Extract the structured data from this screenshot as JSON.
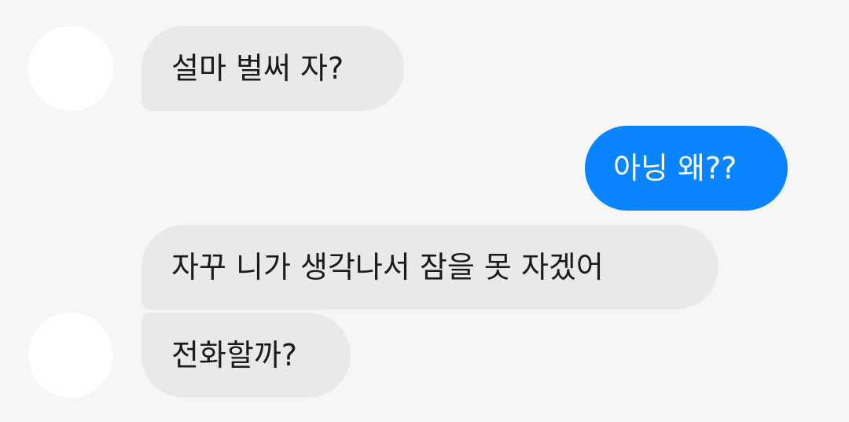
{
  "conversation": {
    "messages": [
      {
        "sender": "them",
        "text": "설마 벌써 자?"
      },
      {
        "sender": "me",
        "text": "아닝 왜??"
      },
      {
        "sender": "them",
        "text": "자꾸 니가 생각나서 잠을 못 자겠어"
      },
      {
        "sender": "them",
        "text": "전화할까?"
      }
    ]
  },
  "colors": {
    "background": "#f6f6f6",
    "incoming_bubble": "#e9e9e9",
    "outgoing_bubble": "#0a84ff",
    "avatar": "#ffffff"
  }
}
